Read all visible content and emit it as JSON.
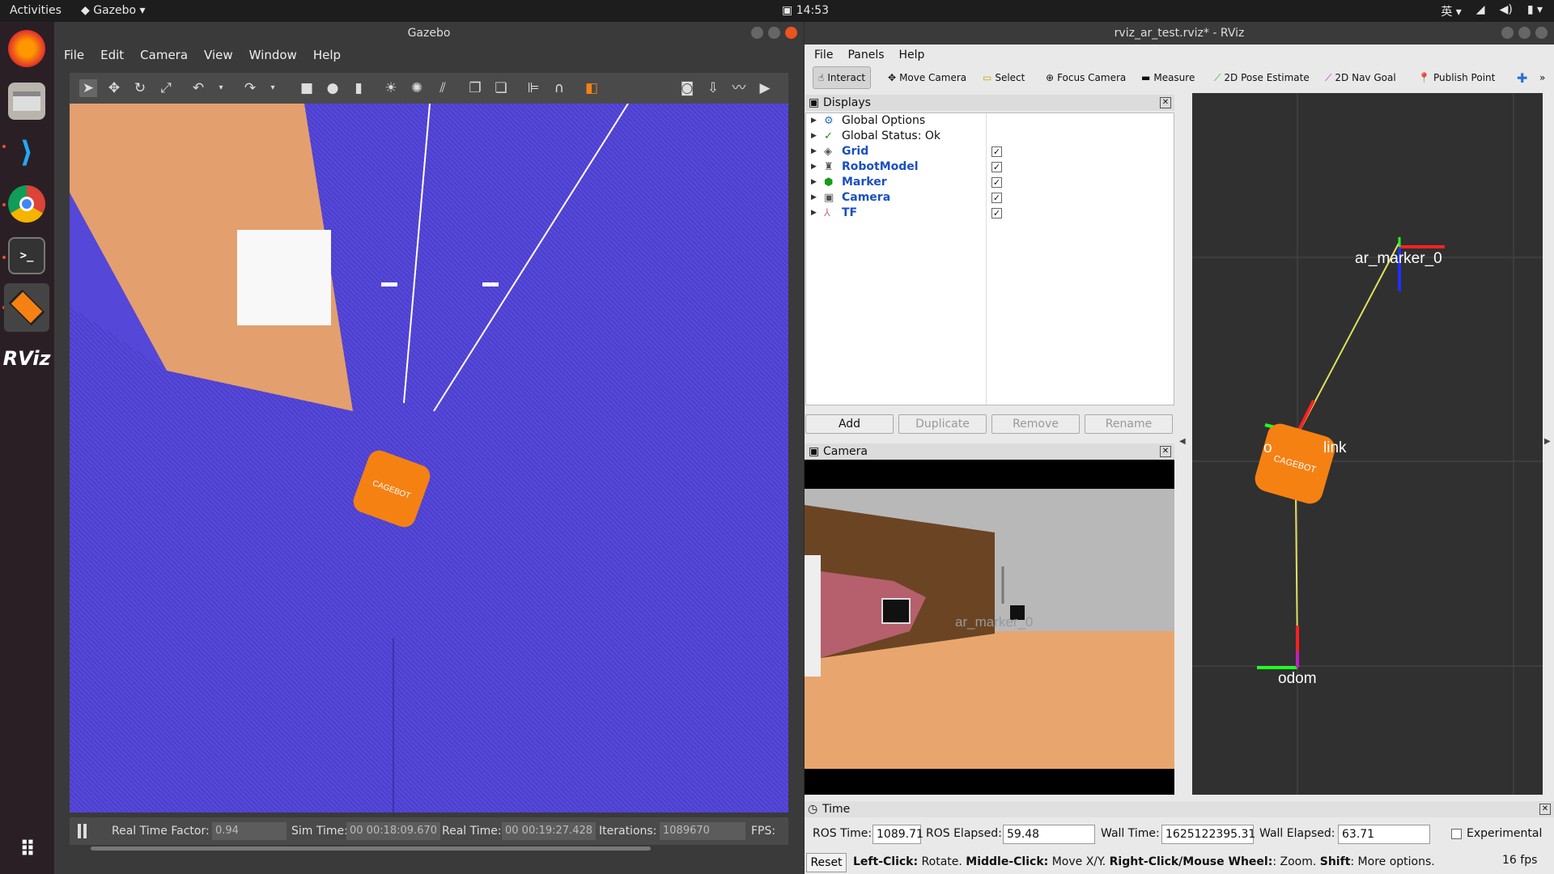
{
  "topbar": {
    "activities": "Activities",
    "app_name": "Gazebo",
    "clock": "14:53",
    "input_method": "英"
  },
  "dock": {
    "apps": [
      "firefox-icon",
      "files-icon",
      "vscode-icon",
      "chrome-icon",
      "terminal-icon",
      "gazebo-icon",
      "rviz-icon"
    ],
    "rviz_label": "RViz"
  },
  "gazebo": {
    "title": "Gazebo",
    "menu": [
      "File",
      "Edit",
      "Camera",
      "View",
      "Window",
      "Help"
    ],
    "status": {
      "rtf_label": "Real Time Factor:",
      "rtf_value": "0.94",
      "sim_label": "Sim Time:",
      "sim_value": "00 00:18:09.670",
      "real_label": "Real Time:",
      "real_value": "00 00:19:27.428",
      "iter_label": "Iterations:",
      "iter_value": "1089670",
      "fps_label": "FPS:"
    },
    "robot_label": "CAGEBOT"
  },
  "rviz": {
    "title": "rviz_ar_test.rviz* - RViz",
    "menu": [
      "File",
      "Panels",
      "Help"
    ],
    "tools": [
      "Interact",
      "Move Camera",
      "Select",
      "Focus Camera",
      "Measure",
      "2D Pose Estimate",
      "2D Nav Goal",
      "Publish Point"
    ],
    "displays_title": "Displays",
    "displays": [
      {
        "name": "Global Options",
        "icon": "gear-icon",
        "check": false,
        "link": false
      },
      {
        "name": "Global Status: Ok",
        "icon": "check-icon",
        "check": false,
        "link": false
      },
      {
        "name": "Grid",
        "icon": "grid-icon",
        "check": true,
        "link": true
      },
      {
        "name": "RobotModel",
        "icon": "robot-icon",
        "check": true,
        "link": true
      },
      {
        "name": "Marker",
        "icon": "marker-icon",
        "check": true,
        "link": true
      },
      {
        "name": "Camera",
        "icon": "camera-icon",
        "check": true,
        "link": true
      },
      {
        "name": "TF",
        "icon": "tf-icon",
        "check": true,
        "link": true
      }
    ],
    "buttons": {
      "add": "Add",
      "duplicate": "Duplicate",
      "remove": "Remove",
      "rename": "Rename"
    },
    "camera_title": "Camera",
    "camera_overlay": "ar_marker_0",
    "view3d": {
      "marker_label": "ar_marker_0",
      "base_label_a": "o",
      "base_label_b": "link",
      "odom_label": "odom",
      "robot_label": "CAGEBOT"
    },
    "time": {
      "title": "Time",
      "ros_time_label": "ROS Time:",
      "ros_time": "1089.71",
      "ros_elapsed_label": "ROS Elapsed:",
      "ros_elapsed": "59.48",
      "wall_time_label": "Wall Time:",
      "wall_time": "1625122395.31",
      "wall_elapsed_label": "Wall Elapsed:",
      "wall_elapsed": "63.71",
      "experimental": "Experimental"
    },
    "status_bar": {
      "reset": "Reset",
      "hint_1b": "Left-Click:",
      "hint_1": " Rotate. ",
      "hint_2b": "Middle-Click:",
      "hint_2": " Move X/Y. ",
      "hint_3b": "Right-Click/Mouse Wheel:",
      "hint_3": ": Zoom. ",
      "hint_4b": "Shift",
      "hint_4": ": More options.",
      "fps": "16 fps"
    }
  }
}
